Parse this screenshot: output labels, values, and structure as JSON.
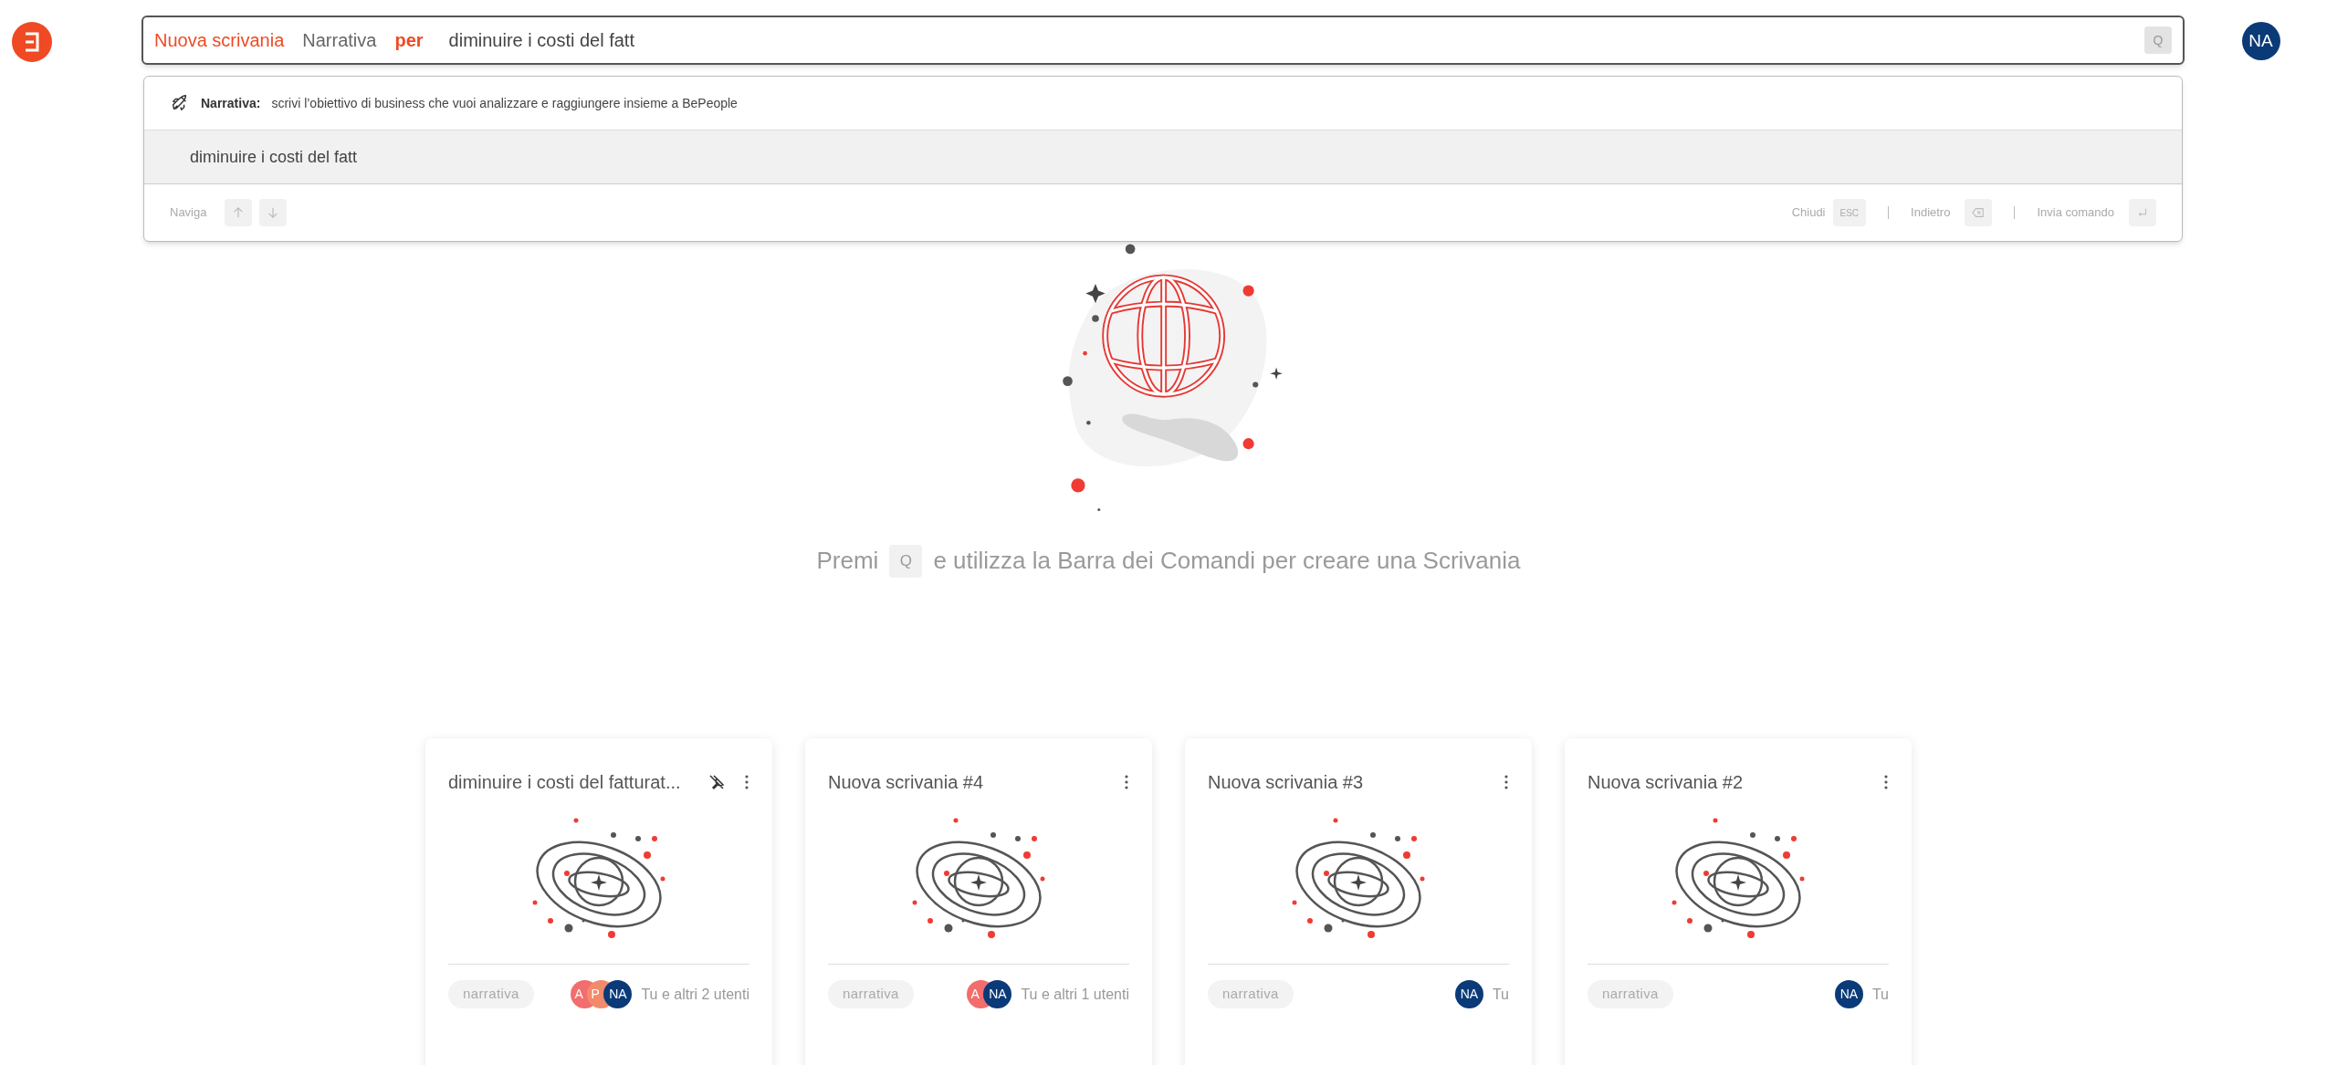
{
  "logo": {
    "kind": "app"
  },
  "command_bar": {
    "tokens": [
      {
        "text": "Nuova scrivania",
        "kind": "command"
      },
      {
        "text": "Narrativa",
        "kind": "option"
      },
      {
        "text": "per",
        "kind": "keyword"
      }
    ],
    "value": "diminuire i costi del fatt",
    "shortcut_key": "Q"
  },
  "user_avatar": {
    "label": "NA"
  },
  "dropdown": {
    "hint": {
      "label": "Narrativa:",
      "text": "scrivi l’obiettivo di business che vuoi analizzare e raggiungere insieme a BePeople"
    },
    "options": [
      {
        "text": "diminuire i costi del fatt",
        "selected": true
      }
    ],
    "footer_left": {
      "label": "Naviga"
    },
    "footer_right": [
      {
        "label": "Chiudi",
        "kind": "esc",
        "key": "ESC"
      },
      {
        "label": "Indietro",
        "kind": "backspace"
      },
      {
        "label": "Invia comando",
        "kind": "enter"
      }
    ]
  },
  "empty_state": {
    "before": "Premi",
    "key": "Q",
    "after": "e utilizza la Barra dei Comandi per creare una Scrivania"
  },
  "cards": [
    {
      "title": "diminuire i costi del fatturat...",
      "pinned": true,
      "tag": "narrativa",
      "avatars": [
        {
          "label": "A",
          "color": "#f26d6d"
        },
        {
          "label": "P",
          "color": "#f28b6b"
        },
        {
          "label": "NA",
          "color": "#0b3a78"
        }
      ],
      "users": "Tu e altri 2 utenti"
    },
    {
      "title": "Nuova scrivania #4",
      "pinned": false,
      "tag": "narrativa",
      "avatars": [
        {
          "label": "A",
          "color": "#f26d6d"
        },
        {
          "label": "NA",
          "color": "#0b3a78"
        }
      ],
      "users": "Tu e altri 1 utenti"
    },
    {
      "title": "Nuova scrivania #3",
      "pinned": false,
      "tag": "narrativa",
      "avatars": [
        {
          "label": "NA",
          "color": "#0b3a78"
        }
      ],
      "users": "Tu"
    },
    {
      "title": "Nuova scrivania #2",
      "pinned": false,
      "tag": "narrativa",
      "avatars": [
        {
          "label": "NA",
          "color": "#0b3a78"
        }
      ],
      "users": "Tu"
    }
  ]
}
